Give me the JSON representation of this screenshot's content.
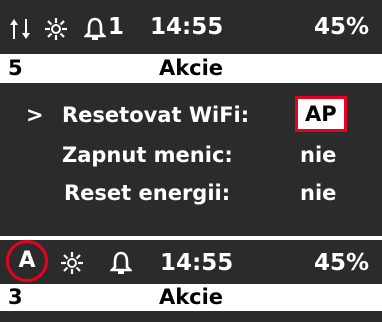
{
  "screen1": {
    "status": {
      "signal_icon": "signal-arrows-icon",
      "sun_icon": "sun-icon",
      "bell_icon": "bell-icon",
      "bell_count": "1",
      "time": "14:55",
      "battery": "45%"
    },
    "title_bar": {
      "number": "5",
      "title": "Akcie"
    },
    "menu": [
      {
        "cursor": ">",
        "label": "Resetovat WiFi:",
        "value": "AP",
        "highlighted": true
      },
      {
        "cursor": "",
        "label": "Zapnut menic:",
        "value": "nie",
        "highlighted": false
      },
      {
        "cursor": "",
        "label": "Reset energii:",
        "value": "nie",
        "highlighted": false
      }
    ]
  },
  "screen2": {
    "status": {
      "mode_badge": "A",
      "sun_icon": "sun-icon",
      "bell_icon": "bell-icon",
      "time": "14:55",
      "battery": "45%"
    },
    "title_bar": {
      "number": "3",
      "title": "Akcie"
    }
  },
  "colors": {
    "screen_bg": "#2b2b2b",
    "highlight_red": "#e8001e",
    "bar_bg": "#ffffff"
  }
}
